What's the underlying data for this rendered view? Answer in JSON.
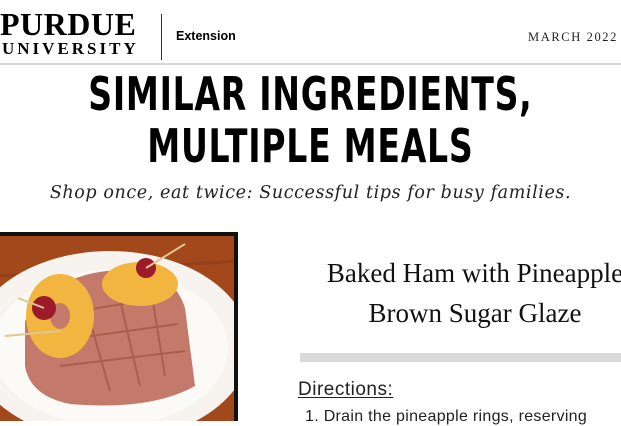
{
  "header": {
    "logo_top": "PURDUE",
    "logo_bottom": "UNIVERSITY",
    "unit": "Extension",
    "issue_date": "MARCH 2022"
  },
  "title": {
    "line1": "SIMILAR INGREDIENTS,",
    "line2": "MULTIPLE MEALS"
  },
  "subtitle": "Shop once, eat twice: Successful tips for busy families.",
  "recipe": {
    "title_line1": "Baked Ham with Pineapple",
    "title_line2": "Brown Sugar Glaze",
    "directions_label": "Directions:",
    "step_1": "1. Drain the pineapple rings, reserving"
  },
  "colors": {
    "table_wood": "#a2481b",
    "plate": "#f7f4ef",
    "ham": "#c47a6a",
    "pineapple": "#f2b540",
    "cherry": "#9b1b2b"
  }
}
